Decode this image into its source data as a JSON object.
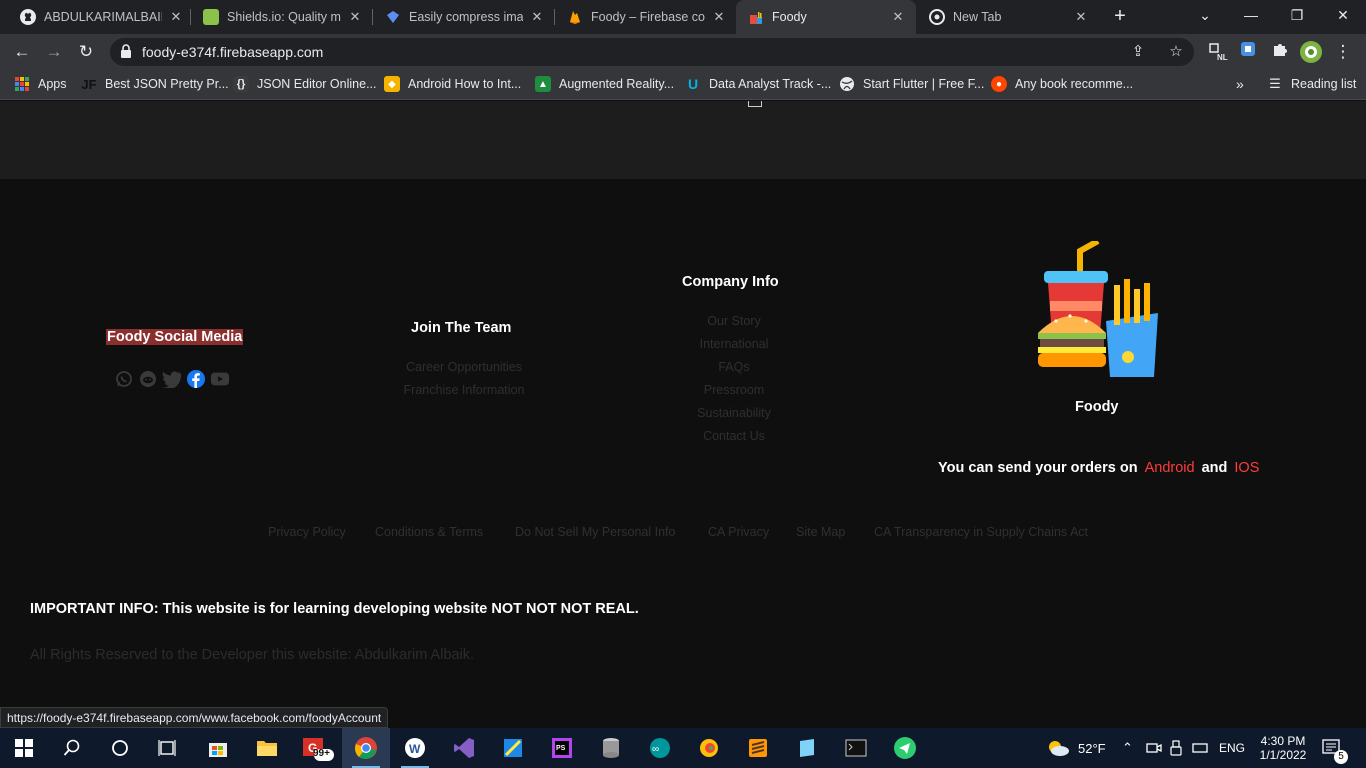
{
  "browser": {
    "tabs": [
      {
        "title": "ABDULKARIMALBAIK/",
        "icon": "github-icon"
      },
      {
        "title": "Shields.io: Quality met",
        "icon": "shields-icon"
      },
      {
        "title": "Easily compress image",
        "icon": "tinypng-icon"
      },
      {
        "title": "Foody – Firebase cons",
        "icon": "firebase-icon"
      },
      {
        "title": "Foody",
        "icon": "foody-icon",
        "active": true
      },
      {
        "title": "New Tab",
        "icon": "chrome-icon"
      }
    ],
    "url": "foody-e374f.firebaseapp.com",
    "bookmarks": [
      {
        "label": "Apps",
        "icon": "apps-grid-icon"
      },
      {
        "label": "Best JSON Pretty Pr...",
        "icon": "jf-icon"
      },
      {
        "label": "JSON Editor Online...",
        "icon": "json-icon"
      },
      {
        "label": "Android How to Int...",
        "icon": "android-bookmark-icon"
      },
      {
        "label": "Augmented Reality...",
        "icon": "ar-icon"
      },
      {
        "label": "Data Analyst Track -...",
        "icon": "udacity-icon"
      },
      {
        "label": "Start Flutter | Free F...",
        "icon": "globe-icon"
      },
      {
        "label": "Any book recomme...",
        "icon": "reddit-icon"
      }
    ],
    "bookmarks_overflow": "»",
    "reading_list": "Reading list",
    "status_url": "https://foody-e374f.firebaseapp.com/www.facebook.com/foodyAccount"
  },
  "footer": {
    "social_title": "Foody Social Media",
    "social_icons": [
      "whatsapp-icon",
      "reddit-icon",
      "twitter-icon",
      "facebook-icon",
      "youtube-icon"
    ],
    "join_title": "Join The Team",
    "join_links": [
      "Career Opportunities",
      "Franchise Information"
    ],
    "company_title": "Company Info",
    "company_links": [
      "Our Story",
      "International",
      "FAQs",
      "Pressroom",
      "Sustainability",
      "Contact Us"
    ],
    "brand_name": "Foody",
    "orders_text": "You can send your orders on",
    "android_link": "Android",
    "and_text": "and",
    "ios_link": "IOS",
    "legal_links": [
      "Privacy Policy",
      "Conditions & Terms",
      "Do Not Sell My Personal Info",
      "CA Privacy",
      "Site Map",
      "CA Transparency in Supply Chains Act"
    ],
    "important_info": "IMPORTANT INFO: This website is for learning developing website NOT NOT NOT REAL.",
    "rights": "All Rights Reserved to the Developer this website: Abdulkarim Albaik."
  },
  "taskbar": {
    "weather": "52°F",
    "language": "ENG",
    "time": "4:30 PM",
    "date": "1/1/2022",
    "notifications": "5",
    "mail_badge": "99+"
  },
  "colors": {
    "accent_red": "#ff3b3b",
    "social_title_bg": "#8b2e2e",
    "page_bg": "#0f0f0f"
  }
}
